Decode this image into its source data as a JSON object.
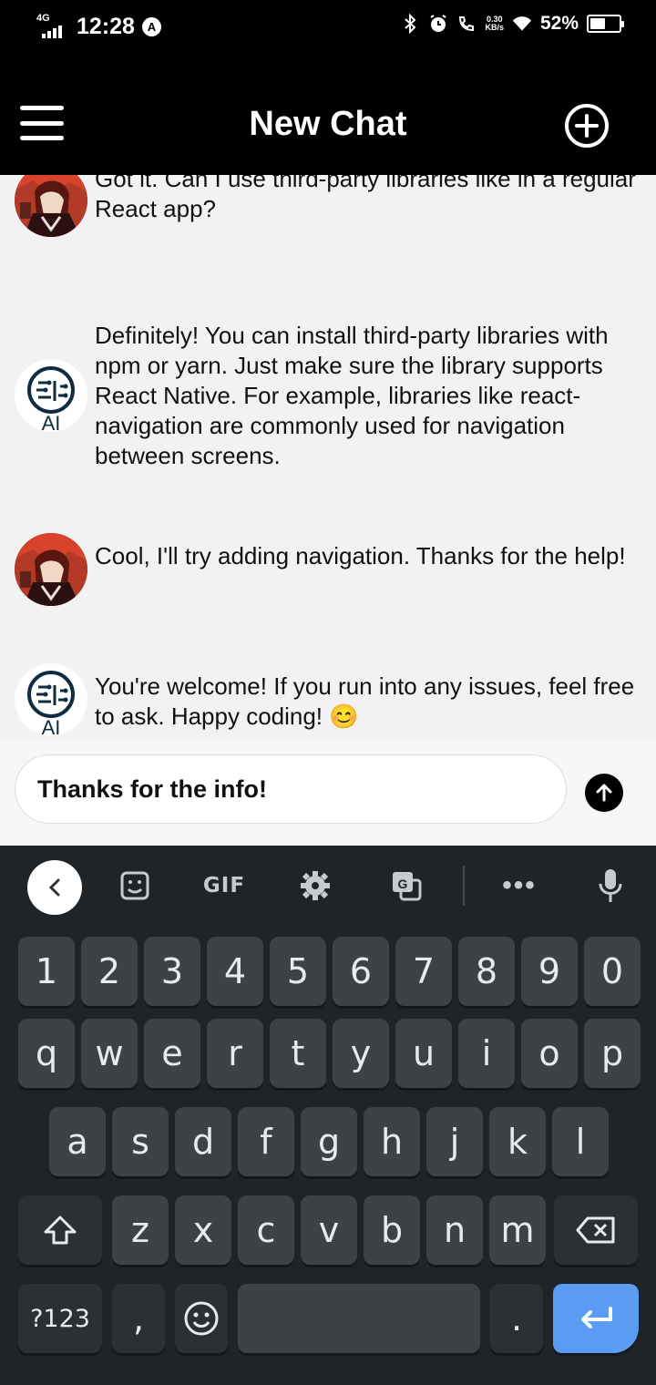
{
  "status_bar": {
    "network": "4G",
    "time": "12:28",
    "speed_value": "0.30",
    "speed_unit": "KB/s",
    "battery_pct": "52%",
    "battery_level": 0.52
  },
  "header": {
    "title": "New Chat"
  },
  "messages": [
    {
      "sender": "user",
      "text": "Got it. Can I use third-party libraries like in a regular React app?"
    },
    {
      "sender": "ai",
      "text": "Definitely! You can install third-party libraries with npm or yarn. Just make sure the library supports React Native. For example, libraries like react-navigation are commonly used for navigation between screens."
    },
    {
      "sender": "user",
      "text": "Cool, I'll try adding navigation. Thanks for the help!"
    },
    {
      "sender": "ai",
      "text": "You're welcome! If you run into any issues, feel free to ask. Happy coding! 😊"
    }
  ],
  "ai_avatar_label": "AI",
  "composer": {
    "value": "Thanks for the info!"
  },
  "keyboard": {
    "toolbar": {
      "gif_label": "GIF"
    },
    "rows": [
      [
        "1",
        "2",
        "3",
        "4",
        "5",
        "6",
        "7",
        "8",
        "9",
        "0"
      ],
      [
        "q",
        "w",
        "e",
        "r",
        "t",
        "y",
        "u",
        "i",
        "o",
        "p"
      ],
      [
        "a",
        "s",
        "d",
        "f",
        "g",
        "h",
        "j",
        "k",
        "l"
      ],
      [
        "z",
        "x",
        "c",
        "v",
        "b",
        "n",
        "m"
      ]
    ],
    "symbols_label": "?123",
    "comma": ",",
    "period": "."
  },
  "colors": {
    "header_bg": "#000000",
    "chat_bg": "#f2f2f2",
    "keyboard_bg": "#1f2428",
    "key_bg": "#3d4246",
    "enter_key": "#5a9cf2"
  }
}
